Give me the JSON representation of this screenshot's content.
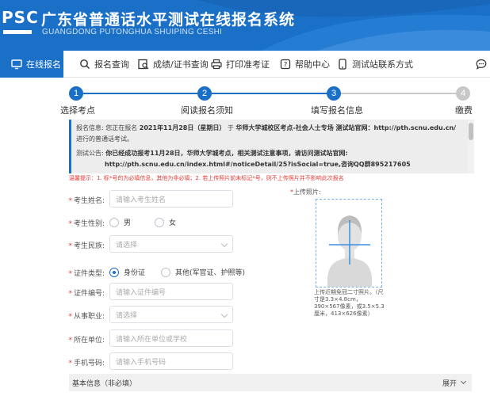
{
  "header": {
    "logo": "PSC",
    "title": "广东省普通话水平测试在线报名系统",
    "subtitle": "GUANGDONG PUTONGHUA SHUIPING CESHI"
  },
  "nav": {
    "items": [
      {
        "label": "在线报名",
        "icon": "monitor-icon",
        "active": true
      },
      {
        "label": "报名查询",
        "icon": "search-icon",
        "active": false
      },
      {
        "label": "成绩/证书查询",
        "icon": "search-doc-icon",
        "active": false
      },
      {
        "label": "打印准考证",
        "icon": "printer-icon",
        "active": false
      },
      {
        "label": "帮助中心",
        "icon": "help-icon",
        "active": false
      },
      {
        "label": "测试站联系方式",
        "icon": "phone-icon",
        "active": false
      }
    ],
    "chat_icon": "chat-icon"
  },
  "steps": [
    {
      "num": "1",
      "label": "选择考点",
      "done": true
    },
    {
      "num": "2",
      "label": "阅读报名须知",
      "done": true
    },
    {
      "num": "3",
      "label": "填写报名信息",
      "done": true
    },
    {
      "num": "4",
      "label": "缴费",
      "done": false
    }
  ],
  "notice": {
    "info_label": "报名信息:",
    "info_text1": "您正在报名",
    "info_date": "2021年11月28日（星期日）",
    "info_text2": "于",
    "info_site": "华师大学城校区考点-社会人士专场 测试站官网：http://pth.scnu.edu.cn/",
    "info_text3": "进行的普通话考试。",
    "announce_label": "测试公告:",
    "announce_text": "你已经成功报考11月28日，华师大学城考点，相关测试注意事项，请访问测试站官网:",
    "announce_url": "http://pth.scnu.edu.cn/index.html#/noticeDetail/25?isSocial=true,咨询QQ群895217605"
  },
  "tip": "温馨提示：1. 标*号的为必填信息，其他为非必填；2. 若上传照片前未标记*号，则不上传照片并不影响此次报名",
  "form": {
    "name_label": "考生姓名:",
    "name_placeholder": "请输入考生姓名",
    "gender_label": "考生性别:",
    "gender_male": "男",
    "gender_female": "女",
    "ethnicity_label": "考生民族:",
    "ethnicity_placeholder": "请选择",
    "id_type_label": "证件类型:",
    "id_type_idcard": "身份证",
    "id_type_other": "其他(军官证、护照等)",
    "id_no_label": "证件编号:",
    "id_no_placeholder": "请输入证件编号",
    "occupation_label": "从事职业:",
    "occupation_placeholder": "请选择",
    "org_label": "所在单位:",
    "org_placeholder": "请输入所在单位或学校",
    "phone_label": "手机号码:",
    "phone_placeholder": "请输入手机号码"
  },
  "photo": {
    "label": "上传照片:",
    "hint": "上传近期免冠二寸照片。（尺寸是3.3×4.8cm，390×567像素，或3.5×5.3厘米，413×626像素）"
  },
  "section": {
    "title": "基本信息（非必填）",
    "expand": "展开"
  },
  "colors": {
    "primary": "#1a6fc7",
    "required": "#e53935",
    "step_pending": "#c8c8c8"
  }
}
